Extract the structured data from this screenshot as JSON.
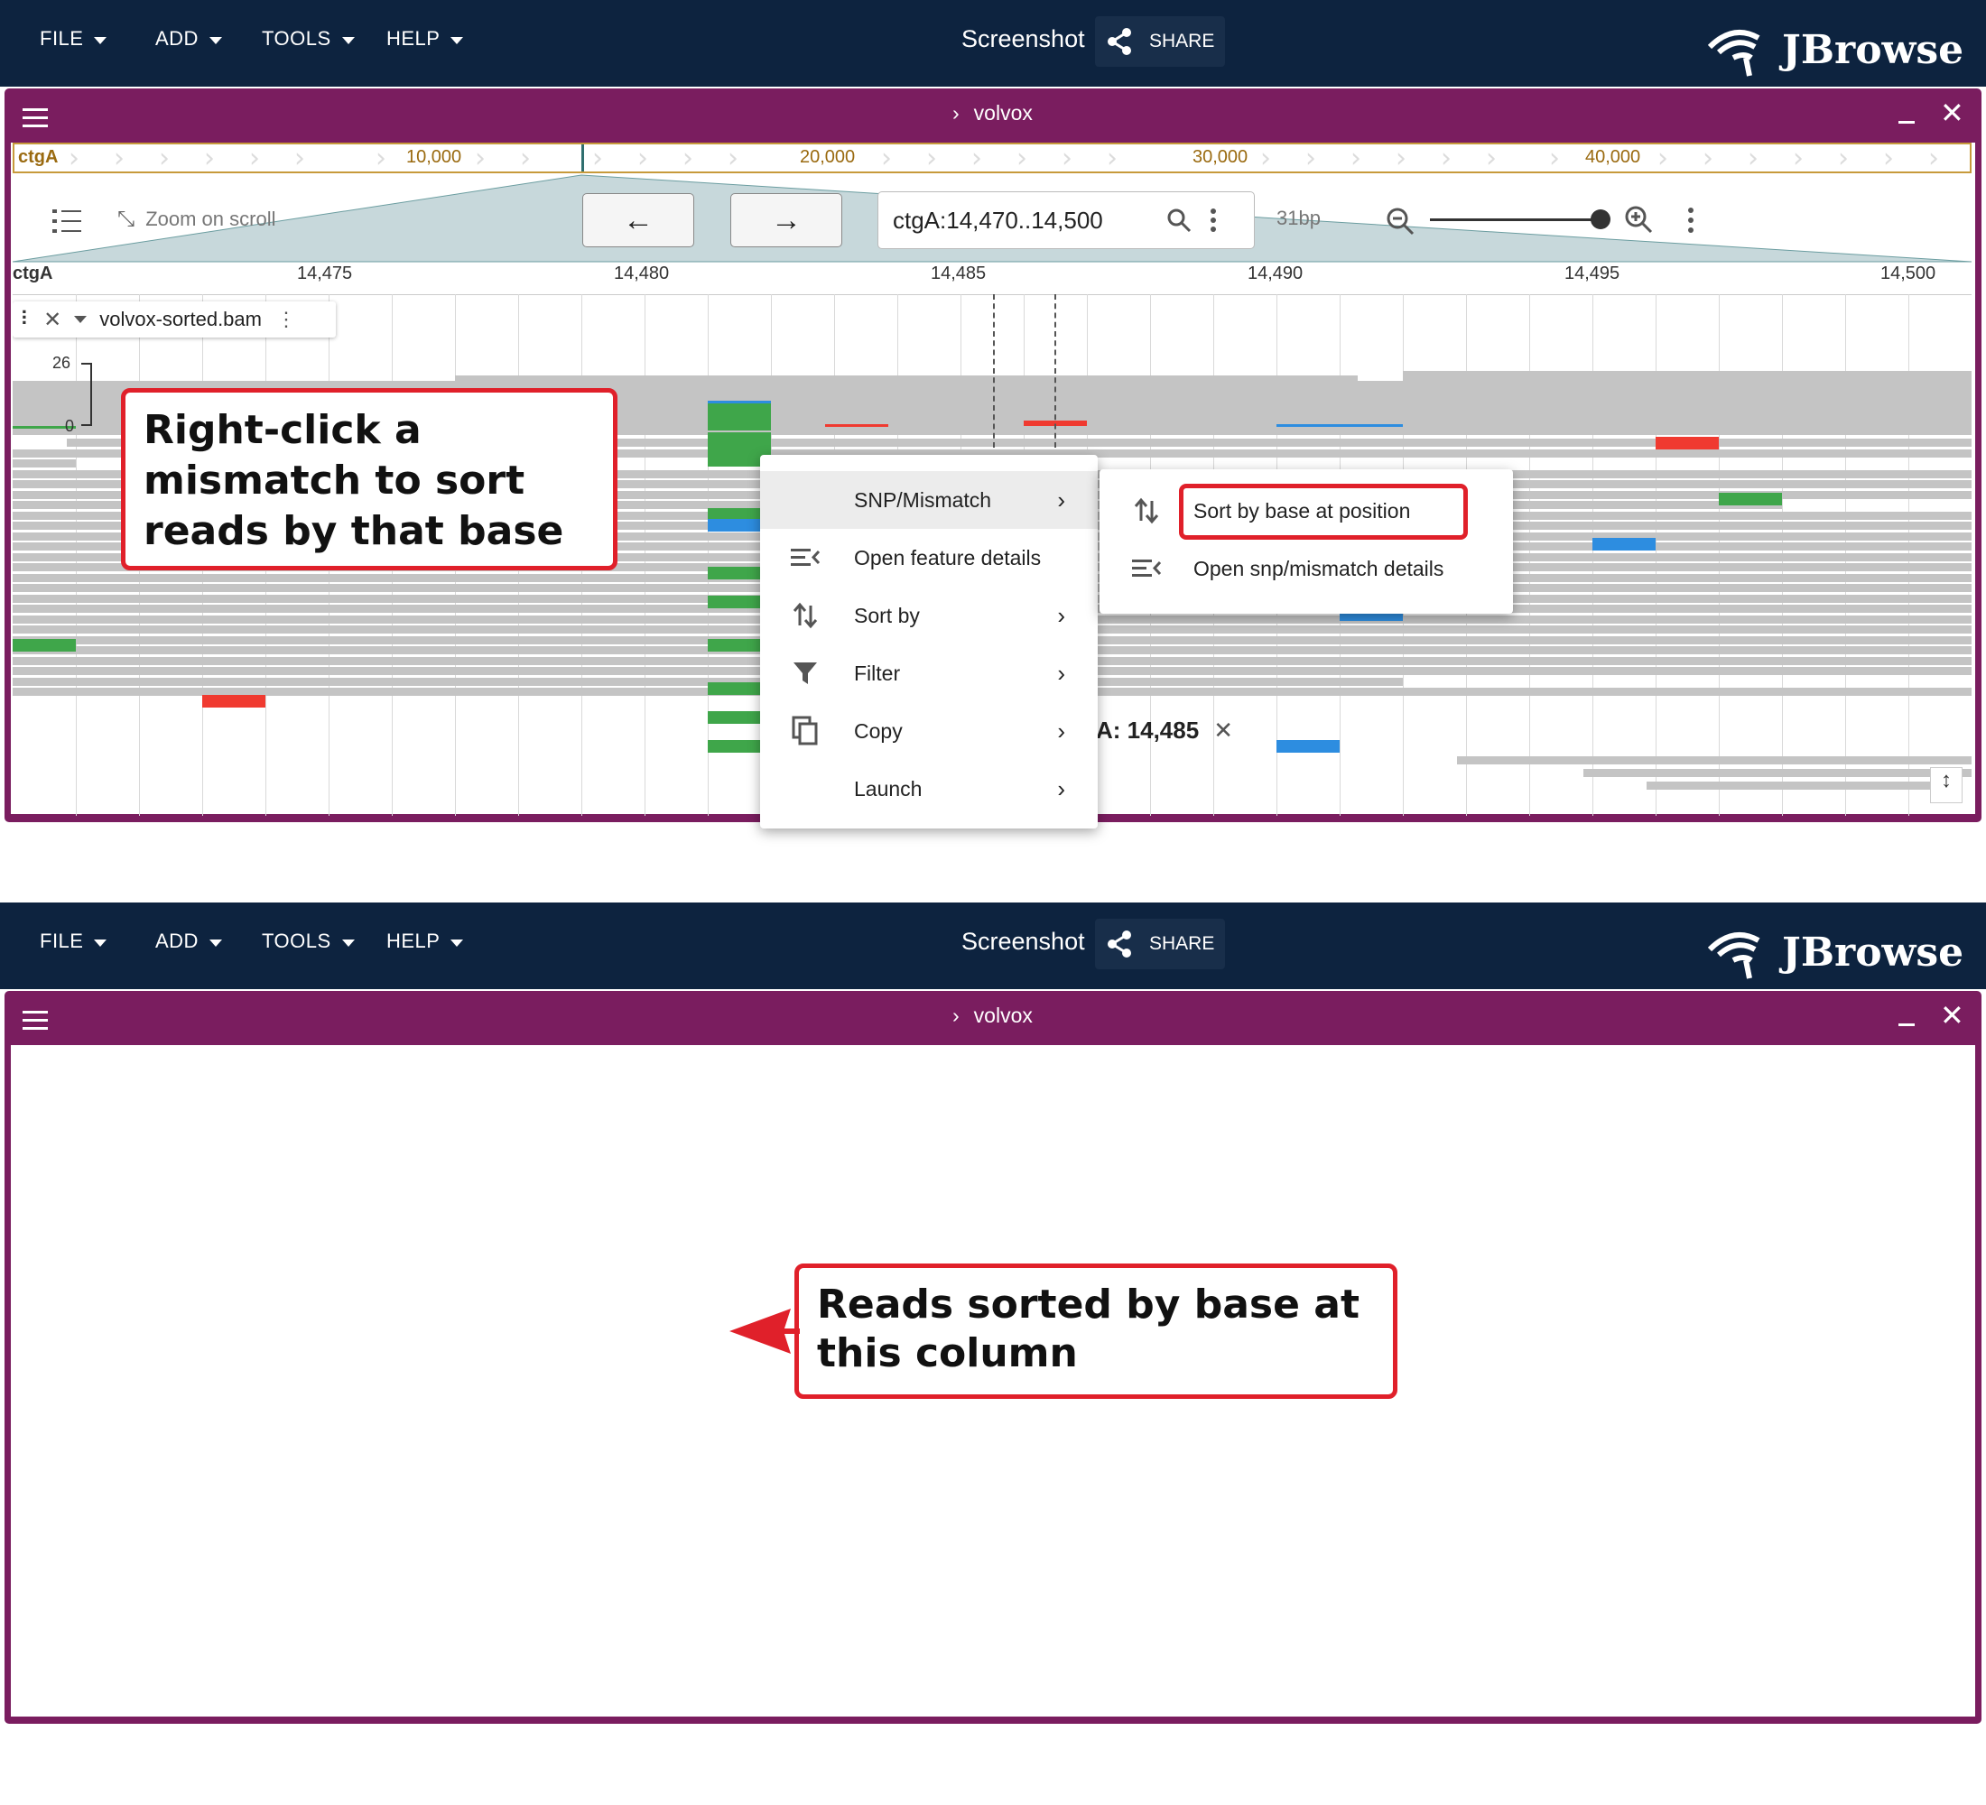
{
  "appbar": {
    "menus": [
      "FILE",
      "ADD",
      "TOOLS",
      "HELP"
    ],
    "session_title": "Screenshot",
    "share_label": "SHARE",
    "logo_text": "JBrowse"
  },
  "view": {
    "title": "volvox",
    "overview": {
      "refname": "ctgA",
      "ticks": [
        "10,000",
        "20,000",
        "30,000",
        "40,000"
      ]
    },
    "toolbar": {
      "zoom_on_scroll": "Zoom on scroll",
      "location": "ctgA:14,470..14,500",
      "bp_label": "31bp"
    },
    "scalebar": {
      "refname": "ctgA",
      "ticks": [
        "14,475",
        "14,480",
        "14,485",
        "14,490",
        "14,495",
        "14,500"
      ]
    },
    "track": {
      "name": "volvox-sorted.bam",
      "coverage_max": "26",
      "coverage_min": "0"
    },
    "position_label": "A: 14,485"
  },
  "context_menu": {
    "items": [
      {
        "label": "SNP/Mismatch",
        "icon": "none",
        "submenu": true
      },
      {
        "label": "Open feature details",
        "icon": "menu-open-icon",
        "submenu": false
      },
      {
        "label": "Sort by",
        "icon": "swap-vert-icon",
        "submenu": true
      },
      {
        "label": "Filter",
        "icon": "filter-icon",
        "submenu": true
      },
      {
        "label": "Copy",
        "icon": "copy-icon",
        "submenu": true
      },
      {
        "label": "Launch",
        "icon": "none",
        "submenu": true
      }
    ]
  },
  "submenu": {
    "items": [
      {
        "label": "Sort by base at position",
        "icon": "swap-vert-icon"
      },
      {
        "label": "Open snp/mismatch details",
        "icon": "menu-open-icon"
      }
    ]
  },
  "callouts": {
    "top": "Right-click a mismatch to sort reads by that base",
    "bottom": "Reads sorted by base at this column"
  },
  "colors": {
    "appbar": "#0d233f",
    "view_border": "#7a1d5f",
    "callout_border": "#e0202a",
    "mismatch_A": "#3fa64a",
    "mismatch_C": "#2d8de0",
    "mismatch_T": "#f03a30"
  }
}
